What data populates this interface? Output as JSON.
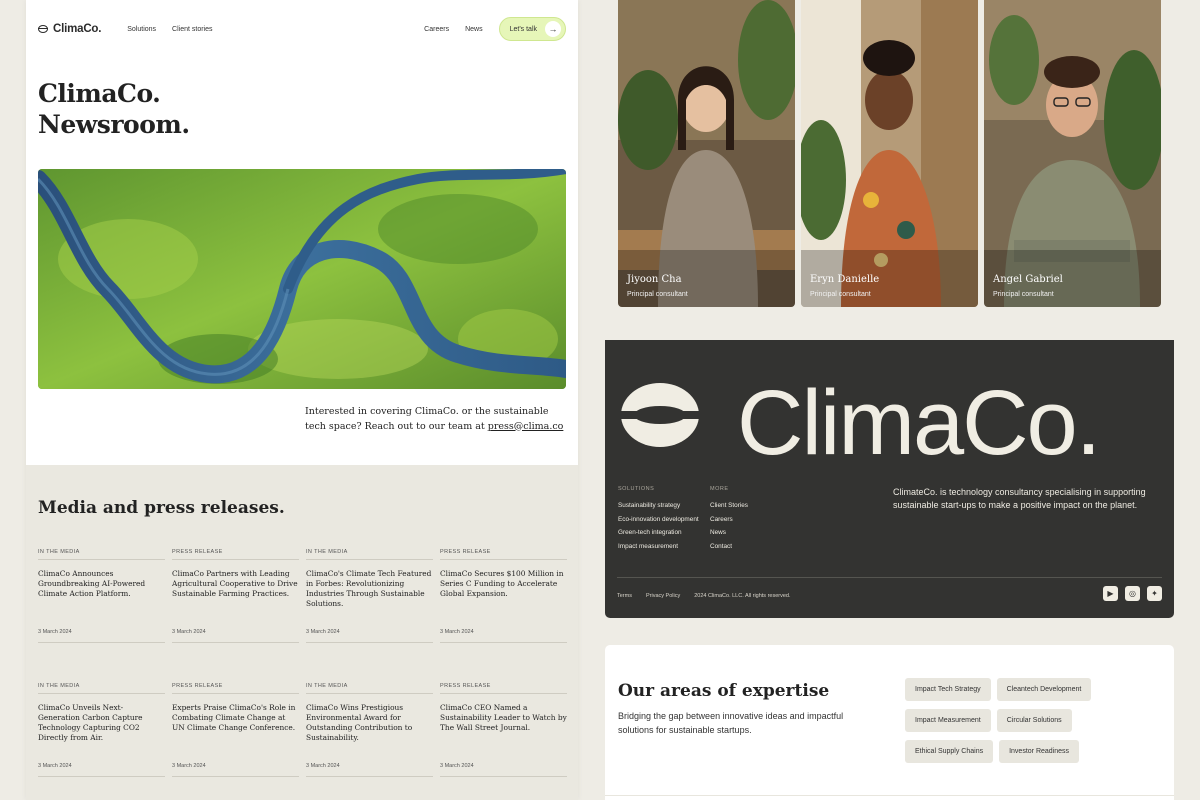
{
  "nav": {
    "logo": "ClimaCo.",
    "links_left": [
      "Solutions",
      "Client stories"
    ],
    "links_right": [
      "Careers",
      "News"
    ],
    "cta": "Let's talk"
  },
  "hero": {
    "title_line1": "ClimaCo.",
    "title_line2": "Newsroom.",
    "contact_text": "Interested in covering ClimaCo. or the sustainable tech space? Reach out to our team at ",
    "contact_email": "press@clima.co"
  },
  "press": {
    "title": "Media and press releases.",
    "items": [
      {
        "type": "IN THE MEDIA",
        "title": "ClimaCo Announces Groundbreaking AI-Powered Climate Action Platform.",
        "date": "3 March 2024"
      },
      {
        "type": "PRESS RELEASE",
        "title": "ClimaCo Partners with Leading Agricultural Cooperative to Drive Sustainable Farming Practices.",
        "date": "3 March 2024"
      },
      {
        "type": "IN THE MEDIA",
        "title": "ClimaCo's Climate Tech Featured in Forbes: Revolutionizing Industries Through Sustainable Solutions.",
        "date": "3 March 2024"
      },
      {
        "type": "PRESS RELEASE",
        "title": "ClimaCo Secures $100 Million in Series C Funding to Accelerate Global Expansion.",
        "date": "3 March 2024"
      },
      {
        "type": "IN THE MEDIA",
        "title": "ClimaCo Unveils Next-Generation Carbon Capture Technology Capturing CO2 Directly from Air.",
        "date": "3 March 2024"
      },
      {
        "type": "PRESS RELEASE",
        "title": "Experts Praise ClimaCo's Role in Combating Climate Change at UN Climate Change Conference.",
        "date": "3 March 2024"
      },
      {
        "type": "IN THE MEDIA",
        "title": "ClimaCo Wins Prestigious Environmental Award for Outstanding Contribution to Sustainability.",
        "date": "3 March 2024"
      },
      {
        "type": "PRESS RELEASE",
        "title": "ClimaCo CEO Named a Sustainability Leader to Watch by The Wall Street Journal.",
        "date": "3 March 2024"
      }
    ]
  },
  "team": [
    {
      "name": "Jiyoon Cha",
      "role": "Principal consultant"
    },
    {
      "name": "Eryn Danielle",
      "role": "Principal consultant"
    },
    {
      "name": "Angel Gabriel",
      "role": "Principal consultant"
    }
  ],
  "footer": {
    "big_logo": "ClimaCo.",
    "solutions_heading": "SOLUTIONS",
    "solutions": [
      "Sustainability strategy",
      "Eco-innovation development",
      "Green-tech integration",
      "Impact measurement"
    ],
    "more_heading": "MORE",
    "more": [
      "Client Stories",
      "Careers",
      "News",
      "Contact"
    ],
    "description": "ClimateCo. is technology consultancy specialising in supporting sustainable start-ups to make a positive impact on the planet.",
    "terms": "Terms",
    "privacy": "Privacy Policy",
    "copyright": "2024 ClimaCo. LLC. All rights reserved.",
    "socials": [
      "youtube-icon",
      "instagram-icon",
      "twitter-icon"
    ]
  },
  "expertise": {
    "title": "Our areas of expertise",
    "description": "Bridging the gap between innovative ideas and impactful solutions for sustainable startups.",
    "tags": [
      "Impact Tech Strategy",
      "Cleantech Development",
      "Impact Measurement",
      "Circular Solutions",
      "Ethical Supply Chains",
      "Investor Readiness"
    ]
  },
  "colors": {
    "accent": "#e6f6b8",
    "footer_bg": "#333331",
    "page_bg": "#eeece5"
  }
}
